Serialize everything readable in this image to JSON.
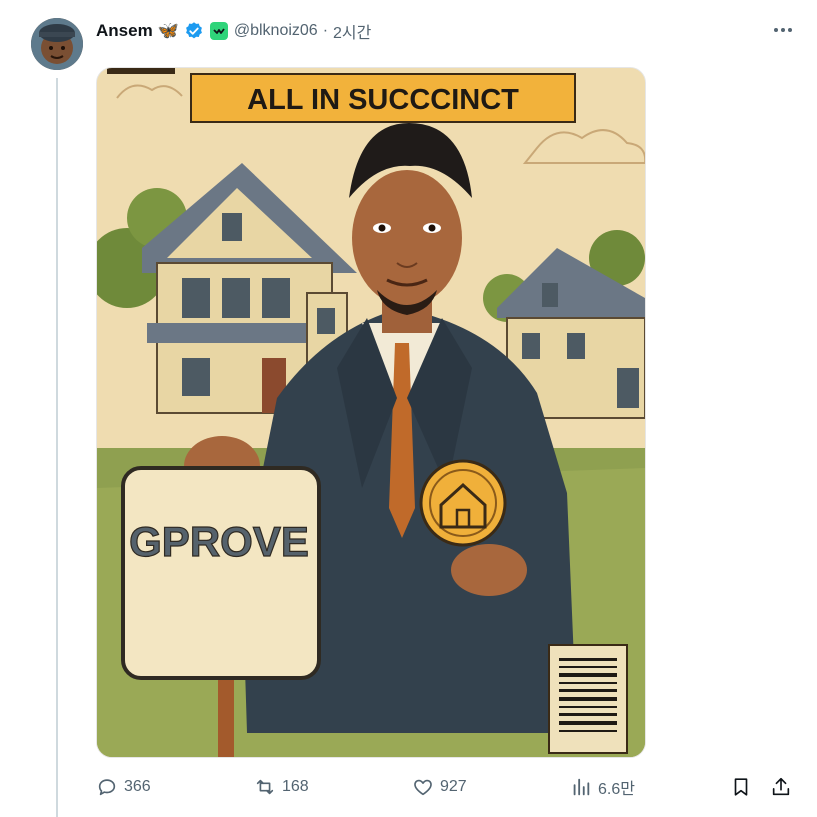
{
  "post": {
    "author_name": "Ansem",
    "author_emoji": "🦋",
    "handle": "@blknoiz06",
    "separator": "·",
    "time": "2시간",
    "image_text": {
      "banner": "ALL IN SUCCCINCT",
      "sign": "GPROVE"
    }
  },
  "actions": {
    "replies": "366",
    "reposts": "168",
    "likes": "927",
    "views": "6.6만"
  },
  "icons": {
    "verified": "verified-badge-icon",
    "affiliate": "affiliate-badge-icon",
    "more": "more-horizontal-icon",
    "reply": "reply-icon",
    "repost": "repost-icon",
    "like": "like-icon",
    "views": "views-icon",
    "bookmark": "bookmark-icon",
    "share": "share-icon"
  },
  "colors": {
    "verified_blue": "#1d9bf0",
    "affiliate_green": "#2fd47a",
    "muted_text": "#536471"
  }
}
